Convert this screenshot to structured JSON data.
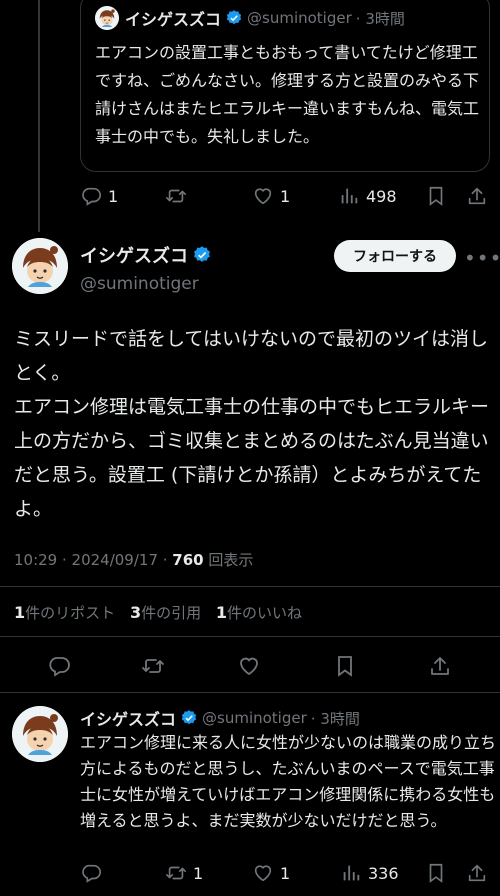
{
  "quoted": {
    "name": "イシゲスズコ",
    "handle": "@suminotiger",
    "time": "· 3時間",
    "text": "エアコンの設置工事ともおもって書いてたけど修理工ですね、ごめんなさい。修理する方と設置のみやる下請けさんはまたヒエラルキー違いますもんね、電気工事士の中でも。失礼しました。",
    "actions": {
      "reply": "1",
      "retweet": "",
      "like": "1",
      "views": "498"
    }
  },
  "main": {
    "name": "イシゲスズコ",
    "handle": "@suminotiger",
    "follow_label": "フォローする",
    "more": "•••",
    "text": "ミスリードで話をしてはいけないので最初のツイは消しとく。\nエアコン修理は電気工事士の仕事の中でもヒエラルキー上の方だから、ゴミ収集とまとめるのはたぶん見当違いだと思う。設置工 (下請けとか孫請）とよみちがえてたよ。",
    "time": "10:29 · 2024/09/17 · ",
    "views_count": "760",
    "views_label": " 回表示",
    "stats": {
      "reposts_count": "1",
      "reposts_label": "件のリポスト",
      "quotes_count": "3",
      "quotes_label": "件の引用",
      "likes_count": "1",
      "likes_label": "件のいいね"
    }
  },
  "reply": {
    "name": "イシゲスズコ",
    "handle": "@suminotiger",
    "time": "· 3時間",
    "text": "エアコン修理に来る人に女性が少ないのは職業の成り立ち方によるものだと思うし、たぶんいまのペースで電気工事士に女性が増えていけばエアコン修理関係に携わる女性も増えると思うよ、まだ実数が少ないだけだと思う。",
    "actions": {
      "reply": "",
      "retweet": "1",
      "like": "1",
      "views": "336"
    }
  },
  "colors": {
    "background": "#000000",
    "text": "#e7e9ea",
    "muted": "#71767b",
    "verified": "#1d9bf0",
    "divider": "#2f3336"
  },
  "icons": [
    "reply-icon",
    "retweet-icon",
    "like-icon",
    "views-icon",
    "bookmark-icon",
    "share-icon",
    "verified-badge-icon"
  ]
}
